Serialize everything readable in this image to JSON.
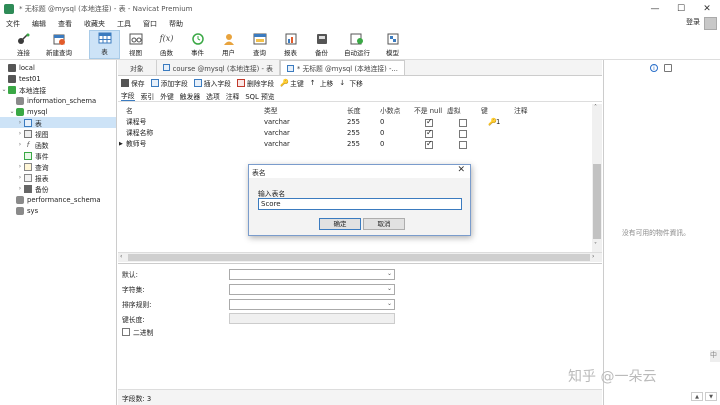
{
  "window": {
    "title": "* 无标题 @mysql (本地连接) - 表 - Navicat Premium",
    "controls": [
      "—",
      "☐",
      "✕"
    ]
  },
  "menu": {
    "items": [
      "文件",
      "编辑",
      "查看",
      "收藏夹",
      "工具",
      "窗口",
      "帮助"
    ],
    "login": "登录"
  },
  "toolbar": {
    "items": [
      {
        "label": "连接",
        "icon": "connection-icon"
      },
      {
        "label": "新建查询",
        "icon": "new-query-icon"
      },
      {
        "label": "表",
        "icon": "table-icon",
        "active": true
      },
      {
        "label": "视图",
        "icon": "view-icon"
      },
      {
        "label": "函数",
        "icon": "function-icon",
        "glyph": "f(x)"
      },
      {
        "label": "事件",
        "icon": "event-icon"
      },
      {
        "label": "用户",
        "icon": "user-icon"
      },
      {
        "label": "查询",
        "icon": "query-icon"
      },
      {
        "label": "报表",
        "icon": "report-icon"
      },
      {
        "label": "备份",
        "icon": "backup-icon"
      },
      {
        "label": "自动运行",
        "icon": "automation-icon"
      },
      {
        "label": "模型",
        "icon": "model-icon"
      }
    ]
  },
  "sidebar": {
    "items": [
      {
        "label": "local",
        "level": 0
      },
      {
        "label": "test01",
        "level": 0
      },
      {
        "label": "本地连接",
        "level": 0
      },
      {
        "label": "information_schema",
        "level": 1
      },
      {
        "label": "mysql",
        "level": 1
      },
      {
        "label": "表",
        "level": 2
      },
      {
        "label": "视图",
        "level": 2
      },
      {
        "label": "函数",
        "level": 2
      },
      {
        "label": "事件",
        "level": 2
      },
      {
        "label": "查询",
        "level": 2
      },
      {
        "label": "报表",
        "level": 2
      },
      {
        "label": "备份",
        "level": 2
      },
      {
        "label": "performance_schema",
        "level": 1
      },
      {
        "label": "sys",
        "level": 1
      }
    ]
  },
  "tabs": {
    "objects": "对象",
    "course": "course @mysql (本地连接) - 表",
    "untitled": "* 无标题 @mysql (本地连接) -..."
  },
  "actions": {
    "save": "保存",
    "add_field": "添加字段",
    "insert_field": "插入字段",
    "delete_field": "删除字段",
    "primary_key": "主键",
    "move_up": "上移",
    "move_down": "下移"
  },
  "subtabs": [
    "字段",
    "索引",
    "外键",
    "触发器",
    "选项",
    "注释",
    "SQL 预览"
  ],
  "grid": {
    "headers": {
      "name": "名",
      "type": "类型",
      "length": "长度",
      "decimals": "小数点",
      "not_null": "不是 null",
      "virtual": "虚拟",
      "key": "键",
      "comment": "注释"
    },
    "rows": [
      {
        "name": "课程号",
        "type": "varchar",
        "length": "255",
        "decimals": "0",
        "not_null": true,
        "virtual": false,
        "key": "1"
      },
      {
        "name": "课程名称",
        "type": "varchar",
        "length": "255",
        "decimals": "0",
        "not_null": true,
        "virtual": false,
        "key": ""
      },
      {
        "name": "教师号",
        "type": "varchar",
        "length": "255",
        "decimals": "0",
        "not_null": true,
        "virtual": false,
        "key": ""
      }
    ]
  },
  "props": {
    "default": "默认:",
    "charset": "字符集:",
    "collation": "排序规则:",
    "key_length": "键长度:",
    "binary": "二进制"
  },
  "status": {
    "field_count": "字段数: 3"
  },
  "info": {
    "empty": "没有可用的物件資訊。",
    "watermark": "知乎 @一朵云",
    "side_tag": "中"
  },
  "dialog": {
    "title": "表名",
    "label": "输入表名",
    "value": "Score",
    "ok": "确定",
    "cancel": "取消"
  }
}
